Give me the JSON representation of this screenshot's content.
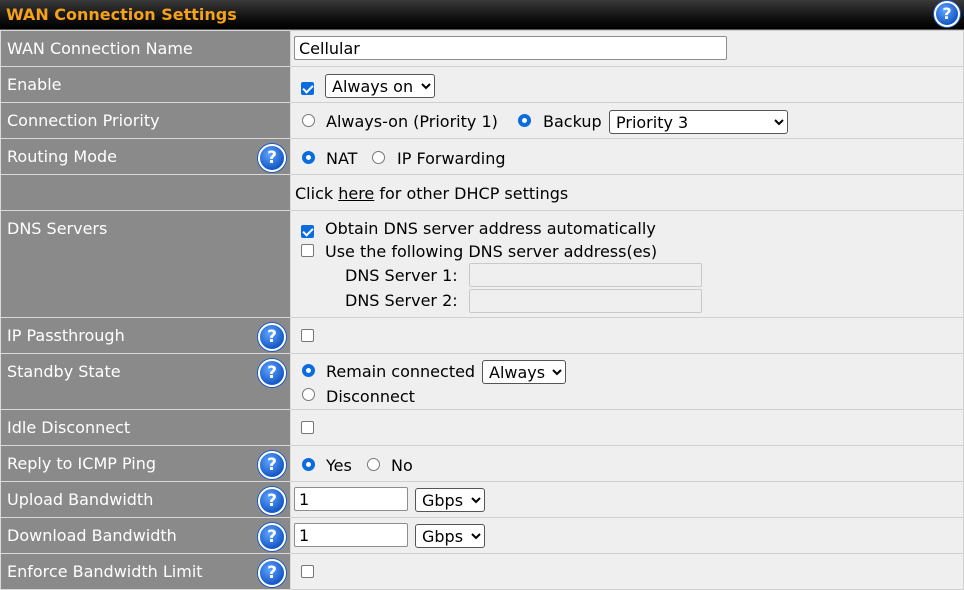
{
  "panel": {
    "title": "WAN Connection Settings"
  },
  "rows": {
    "name": {
      "label": "WAN Connection Name",
      "value": "Cellular"
    },
    "enable": {
      "label": "Enable",
      "checked": true,
      "select": "Always on"
    },
    "priority": {
      "label": "Connection Priority",
      "opt1": "Always-on (Priority 1)",
      "opt2": "Backup",
      "select": "Priority 3",
      "selected": "Backup"
    },
    "routing": {
      "label": "Routing Mode",
      "opt1": "NAT",
      "opt2": "IP Forwarding",
      "selected": "NAT"
    },
    "dhcp": {
      "prefix": "Click",
      "link": "here",
      "suffix": "for other DHCP settings"
    },
    "dns": {
      "label": "DNS Servers",
      "auto_label": "Obtain DNS server address automatically",
      "auto_checked": true,
      "manual_label": "Use the following DNS server address(es)",
      "manual_checked": false,
      "server1_label": "DNS Server 1:",
      "server2_label": "DNS Server 2:",
      "server1": "",
      "server2": ""
    },
    "passthrough": {
      "label": "IP Passthrough",
      "checked": false
    },
    "standby": {
      "label": "Standby State",
      "opt1": "Remain connected",
      "select": "Always",
      "opt2": "Disconnect",
      "selected": "Remain connected"
    },
    "idle": {
      "label": "Idle Disconnect",
      "checked": false
    },
    "icmp": {
      "label": "Reply to ICMP Ping",
      "opt1": "Yes",
      "opt2": "No",
      "selected": "Yes"
    },
    "upload": {
      "label": "Upload Bandwidth",
      "value": "1",
      "unit": "Gbps"
    },
    "download": {
      "label": "Download Bandwidth",
      "value": "1",
      "unit": "Gbps"
    },
    "enforce": {
      "label": "Enforce Bandwidth Limit",
      "checked": false
    }
  },
  "help_glyph": "?",
  "colors": {
    "header_title": "#f5a21a",
    "label_bg": "#8a8a8a",
    "value_bg": "#efefef",
    "accent": "#0a6cdf"
  }
}
